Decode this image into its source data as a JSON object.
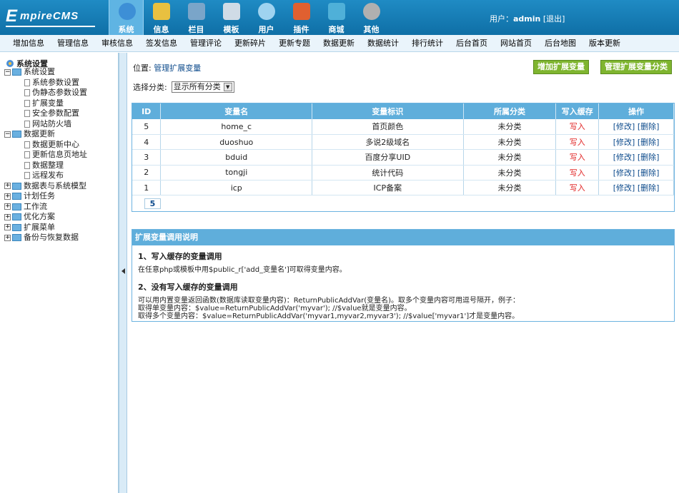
{
  "logo": {
    "first": "E",
    "rest": "mpireCMS"
  },
  "nav": [
    {
      "label": "系统",
      "icon": "globe-icon",
      "color": "#3d8fd6",
      "active": true
    },
    {
      "label": "信息",
      "icon": "note-icon",
      "color": "#e8c040"
    },
    {
      "label": "栏目",
      "icon": "folder-icon",
      "color": "#7aa5c9"
    },
    {
      "label": "模板",
      "icon": "template-icon",
      "color": "#d0dbe6"
    },
    {
      "label": "用户",
      "icon": "user-icon",
      "color": "#9fd3f0"
    },
    {
      "label": "插件",
      "icon": "tools-icon",
      "color": "#e06030"
    },
    {
      "label": "商城",
      "icon": "card-icon",
      "color": "#4fb0d8"
    },
    {
      "label": "其他",
      "icon": "gear-icon",
      "color": "#b0b0b0"
    }
  ],
  "user": {
    "prefix": "用户：",
    "name": "admin",
    "logout": "[退出]"
  },
  "subnav": [
    "增加信息",
    "管理信息",
    "审核信息",
    "签发信息",
    "管理评论",
    "更新碎片",
    "更新专题",
    "数据更新",
    "数据统计",
    "排行统计",
    "后台首页",
    "网站首页",
    "后台地图",
    "版本更新"
  ],
  "sidebar": {
    "root": "系统设置",
    "items": [
      {
        "type": "folder",
        "label": "系统设置",
        "pm": "−",
        "level": 0
      },
      {
        "type": "doc",
        "label": "系统参数设置",
        "level": 1
      },
      {
        "type": "doc",
        "label": "伪静态参数设置",
        "level": 1
      },
      {
        "type": "doc",
        "label": "扩展变量",
        "level": 1
      },
      {
        "type": "doc",
        "label": "安全参数配置",
        "level": 1
      },
      {
        "type": "doc",
        "label": "网站防火墙",
        "level": 1
      },
      {
        "type": "folder",
        "label": "数据更新",
        "pm": "−",
        "level": 0
      },
      {
        "type": "doc",
        "label": "数据更新中心",
        "level": 1
      },
      {
        "type": "doc",
        "label": "更新信息页地址",
        "level": 1
      },
      {
        "type": "doc",
        "label": "数据整理",
        "level": 1
      },
      {
        "type": "doc",
        "label": "远程发布",
        "level": 1
      },
      {
        "type": "folder",
        "label": "数据表与系统模型",
        "pm": "+",
        "level": 0
      },
      {
        "type": "folder",
        "label": "计划任务",
        "pm": "+",
        "level": 0
      },
      {
        "type": "folder",
        "label": "工作流",
        "pm": "+",
        "level": 0
      },
      {
        "type": "folder",
        "label": "优化方案",
        "pm": "+",
        "level": 0
      },
      {
        "type": "folder",
        "label": "扩展菜单",
        "pm": "+",
        "level": 0
      },
      {
        "type": "folder",
        "label": "备份与恢复数据",
        "pm": "+",
        "level": 0
      }
    ]
  },
  "content": {
    "location_prefix": "位置: ",
    "location_link": "管理扩展变量",
    "btn_add": "增加扩展变量",
    "btn_manage": "管理扩展变量分类",
    "filter_label": "选择分类:",
    "filter_value": "显示所有分类",
    "table": {
      "headers": [
        "ID",
        "变量名",
        "变量标识",
        "所属分类",
        "写入缓存",
        "操作"
      ],
      "rows": [
        [
          "5",
          "home_c",
          "首页颜色",
          "未分类",
          "写入",
          "[修改] [删除]"
        ],
        [
          "4",
          "duoshuo",
          "多说2级域名",
          "未分类",
          "写入",
          "[修改] [删除]"
        ],
        [
          "3",
          "bduid",
          "百度分享UID",
          "未分类",
          "写入",
          "[修改] [删除]"
        ],
        [
          "2",
          "tongji",
          "统计代码",
          "未分类",
          "写入",
          "[修改] [删除]"
        ],
        [
          "1",
          "icp",
          "ICP备案",
          "未分类",
          "写入",
          "[修改] [删除]"
        ]
      ],
      "pager": "5"
    },
    "help": {
      "title": "扩展变量调用说明",
      "s1_title": "1、写入缓存的变量调用",
      "s1_text": "在任意php或模板中用$public_r['add_变量名']可取得变量内容。",
      "s2_title": "2、没有写入缓存的变量调用",
      "s2_line1": "可以用内置变量返回函数(数据库读取变量内容)：ReturnPublicAddVar(变量名)。取多个变量内容可用逗号隔开，例子：",
      "s2_line2": "取得单变量内容：$value=ReturnPublicAddVar('myvar'); //$value就是变量内容。",
      "s2_line3": "取得多个变量内容：$value=ReturnPublicAddVar('myvar1,myvar2,myvar3'); //$value['myvar1']才是变量内容。"
    }
  }
}
